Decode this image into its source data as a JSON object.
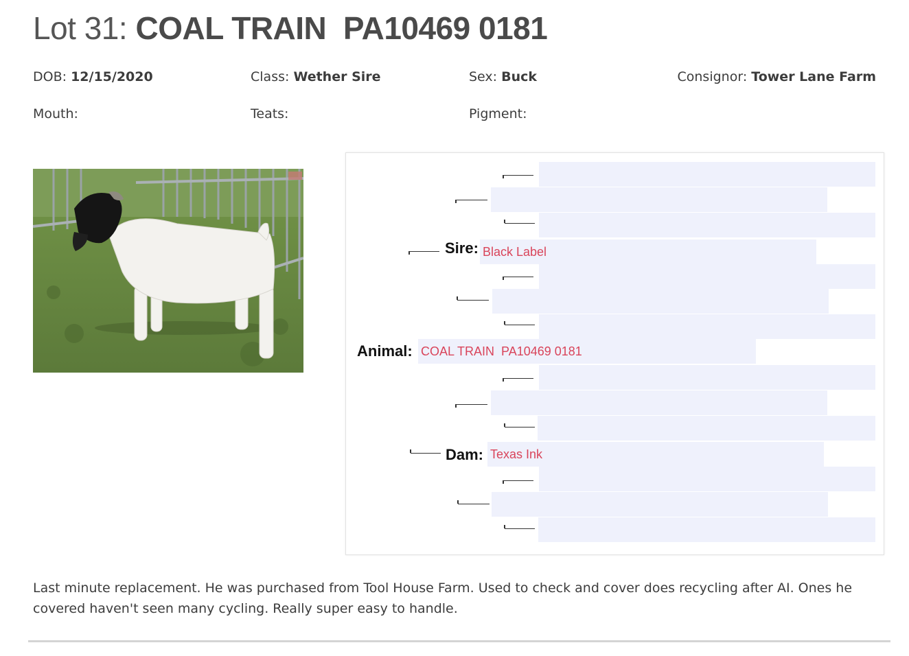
{
  "lot": {
    "prefix": "Lot 31:",
    "name": "COAL TRAIN  PA10469 0181"
  },
  "details": {
    "dob": {
      "label": "DOB:",
      "value": "12/15/2020"
    },
    "class": {
      "label": "Class:",
      "value": "Wether Sire"
    },
    "sex": {
      "label": "Sex:",
      "value": "Buck"
    },
    "consignor": {
      "label": "Consignor:",
      "value": "Tower Lane Farm"
    },
    "mouth": {
      "label": "Mouth:",
      "value": ""
    },
    "teats": {
      "label": "Teats:",
      "value": ""
    },
    "pigment": {
      "label": "Pigment:",
      "value": ""
    }
  },
  "pedigree": {
    "sire": {
      "label": "Sire:",
      "value": "Black Label"
    },
    "animal": {
      "label": "Animal:",
      "value": "COAL TRAIN  PA10469 0181"
    },
    "dam": {
      "label": "Dam:",
      "value": "Texas Ink"
    }
  },
  "description": "Last minute replacement. He was purchased from Tool House Farm. Used to check and cover does recycling after AI.  Ones he covered haven't seen many cycling. Really super easy to handle.",
  "colors": {
    "pedigree_value": "#d9445a",
    "pedigree_box": "#eff1fc"
  }
}
